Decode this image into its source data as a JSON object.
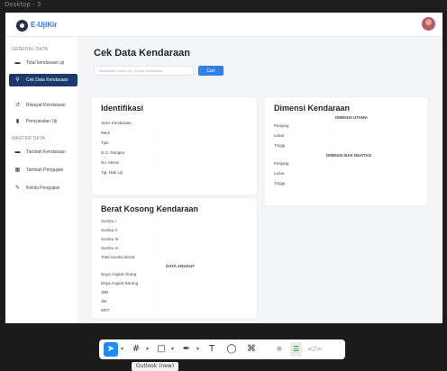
{
  "frame_label": "Desktop - 3",
  "app": {
    "logo_text": "E-UjiKir"
  },
  "sidebar": {
    "general_header": "GENERAL DATA",
    "master_header": "MASTER DATA",
    "items": [
      {
        "label": "Total kendaraan uji",
        "icon": "car-icon"
      },
      {
        "label": "Cek Data Kendaraan",
        "icon": "search-icon",
        "active": true
      },
      {
        "label": "Riwayat Kendaraan",
        "icon": "history-icon"
      },
      {
        "label": "Persyaratan Uji",
        "icon": "document-icon"
      },
      {
        "label": "Tambah Kendaraan",
        "icon": "car-icon"
      },
      {
        "label": "Tambah Pengujian",
        "icon": "calendar-icon"
      },
      {
        "label": "Kelola Pengujian",
        "icon": "edit-icon"
      }
    ]
  },
  "main": {
    "title": "Cek Data Kendaraan",
    "search_placeholder": "Masukkan nomor uji / nomor kendaraan",
    "search_button": "Cari"
  },
  "identifikasi": {
    "title": "Identifikasi",
    "rows": [
      "Jenis Kendaraan",
      "Merk",
      "Tipe",
      "N.O. Rangka",
      "No. Mesin",
      "Tgl. Mati Uji"
    ]
  },
  "dimensi": {
    "title": "Dimensi Kendaraan",
    "utama_header": "DIMENSI UTAMA",
    "utama_rows": [
      "Panjang",
      "Lebar",
      "Tinggi"
    ],
    "bak_header": "DIMENSI BAK MUATAN",
    "bak_rows": [
      "Panjang",
      "Lebar",
      "Tinggi"
    ]
  },
  "berat": {
    "title": "Berat Kosong Kendaraan",
    "rows": [
      "Sumbu I",
      "Sumbu II",
      "Sumbu III",
      "Sumbu IV",
      "Total Sumbu Berat"
    ],
    "daya_header": "DAYA ANGKUT",
    "daya_rows": [
      "Daya Angkut Orang",
      "Daya Angkut Barang",
      "JBB",
      "JBI",
      "MST"
    ]
  },
  "colon": ":",
  "toolbar": {
    "items": [
      "move-tool",
      "frame-tool",
      "shape-tool",
      "pen-tool",
      "text-tool",
      "comment-tool",
      "actions-tool",
      "multiplayer-tool",
      "dev-mode-tool",
      "code-tool"
    ]
  },
  "tooltip": "Outlook (new)"
}
